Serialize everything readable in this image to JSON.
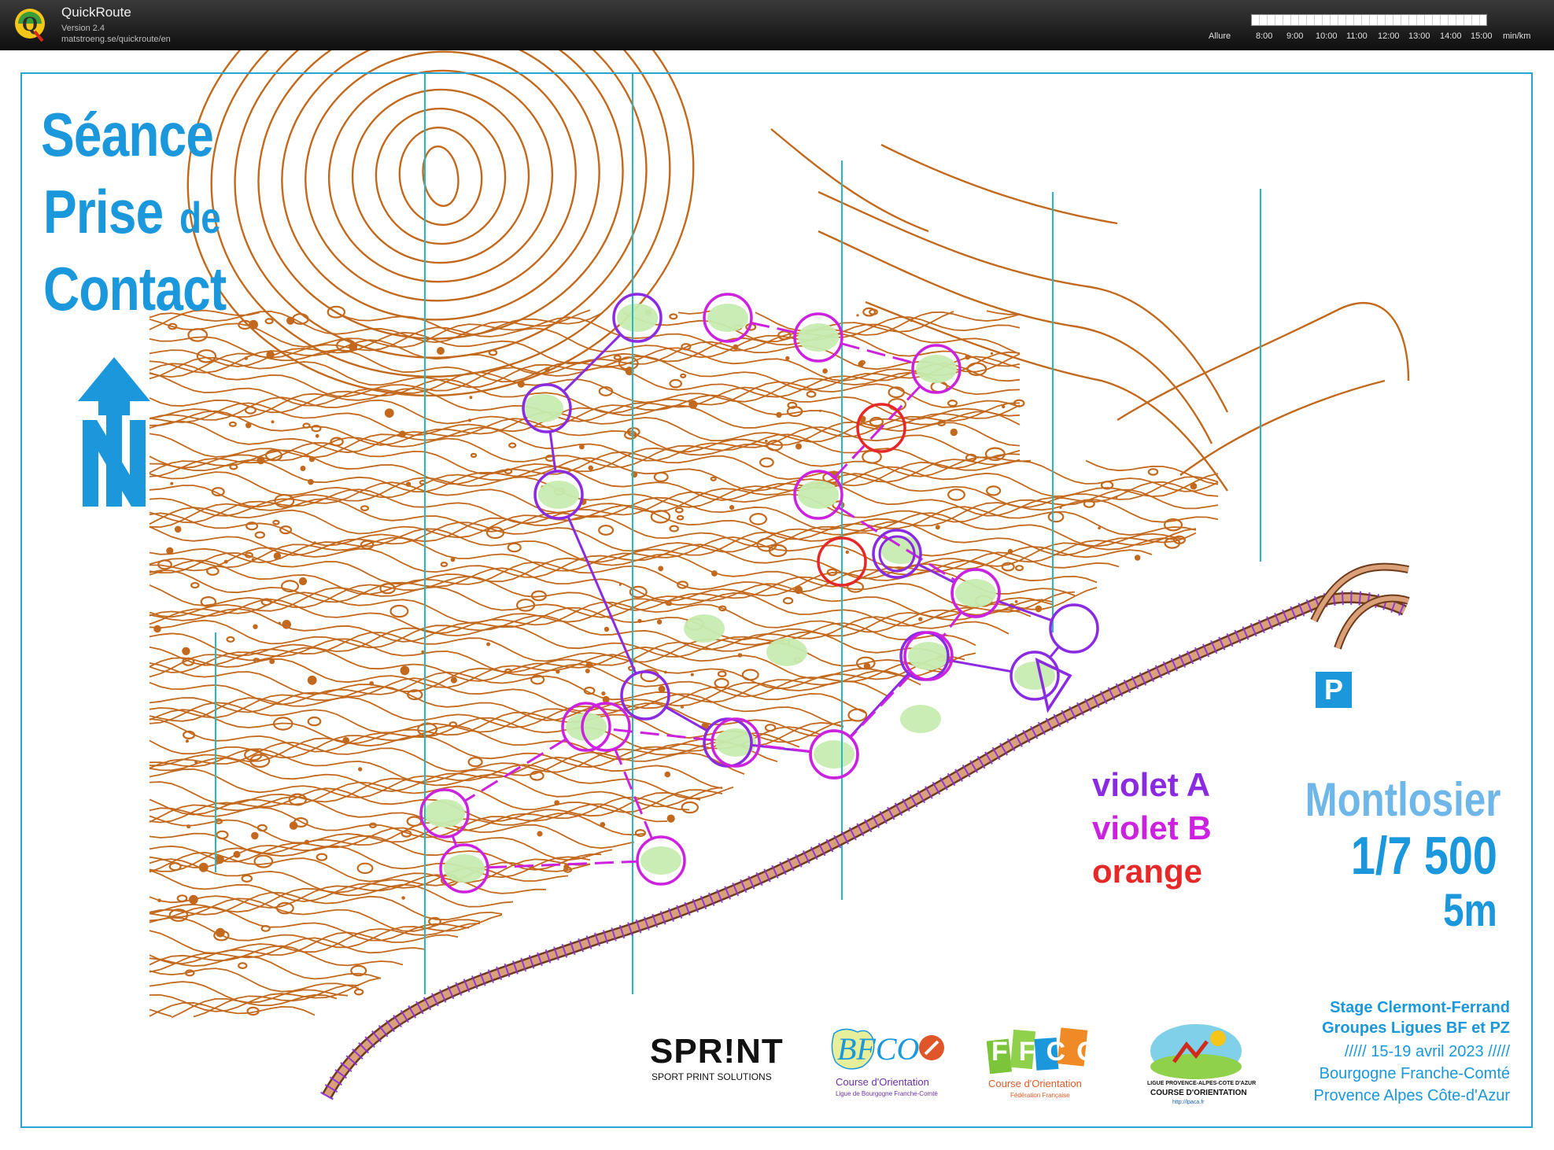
{
  "app": {
    "name": "QuickRoute",
    "version": "Version 2.4",
    "url": "matstroeng.se/quickroute/en"
  },
  "pace_scale": {
    "label": "Allure",
    "ticks": [
      "8:00",
      "9:00",
      "10:00",
      "11:00",
      "12:00",
      "13:00",
      "14:00",
      "15:00"
    ],
    "unit": "min/km"
  },
  "map": {
    "title_line1": "Séance",
    "title_line2": "Prise",
    "title_line2b": "de",
    "title_line3": "Contact",
    "place": "Montlosier",
    "scale": "1/7 500",
    "contour_interval": "5m",
    "parking_symbol": "P",
    "north_arrow": "N",
    "legend": [
      {
        "label": "violet A",
        "color": "#8a2be2"
      },
      {
        "label": "violet B",
        "color": "#cc22e0"
      },
      {
        "label": "orange",
        "color": "#e62828"
      }
    ],
    "event": {
      "line1": "Stage Clermont-Ferrand",
      "line2": "Groupes Ligues BF et PZ",
      "line3": "///// 15-19 avril 2023 /////",
      "line4": "Bourgogne Franche-Comté",
      "line5": "Provence Alpes Côte-d'Azur"
    },
    "sponsors": {
      "sprint_name": "SPR!NT",
      "sprint_sub": "SPORT PRINT SOLUTIONS",
      "bfco_logo": "BFCO",
      "bfco_line1": "Course d'Orientation",
      "bfco_line2": "Ligue de Bourgogne Franche-Comté",
      "ffco_logo": "FFCO",
      "ffco_line1": "Course d'Orientation",
      "ffco_line2": "Fédération Française",
      "lpaca_line1": "LIGUE PROVENCE-ALPES-COTE D'AZUR",
      "lpaca_line2": "COURSE D'ORIENTATION",
      "lpaca_line3": "http://lpaca.fr"
    }
  },
  "colors": {
    "contour": "#c2691d",
    "magnetic_north": "#27b8c4",
    "violet_a": "#8a2be2",
    "violet_b": "#cc22e0",
    "orange_course": "#e62828",
    "vegetation": "#c6ecb0",
    "title_blue": "#1b97db"
  }
}
